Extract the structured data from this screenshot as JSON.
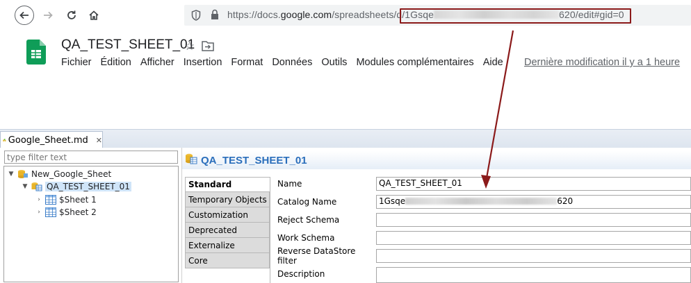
{
  "browser": {
    "url_prefix": "https://docs.",
    "url_domain": "google.com",
    "url_path_start": "/spreadsheets/d/1Gsqe",
    "url_path_end": "620/edit#gid=0"
  },
  "sheet": {
    "title": "QA_TEST_SHEET_01",
    "menu": [
      "Fichier",
      "Édition",
      "Afficher",
      "Insertion",
      "Format",
      "Données",
      "Outils",
      "Modules complémentaires",
      "Aide"
    ],
    "last_modified": "Dernière modification il y a 1 heure"
  },
  "ide": {
    "tab_label": "Google_Sheet.md",
    "filter_placeholder": "type filter text",
    "tree": {
      "root": "New_Google_Sheet",
      "child": "QA_TEST_SHEET_01",
      "sheet1": "$Sheet 1",
      "sheet2": "$Sheet 2"
    },
    "section_title": "QA_TEST_SHEET_01",
    "tabs": [
      "Standard",
      "Temporary Objects",
      "Customization",
      "Deprecated",
      "Externalize",
      "Core"
    ],
    "props": {
      "name_label": "Name",
      "name_value": "QA_TEST_SHEET_01",
      "catalog_label": "Catalog Name",
      "catalog_prefix": "1Gsqe",
      "catalog_suffix": "620",
      "reject_label": "Reject Schema",
      "work_label": "Work Schema",
      "reverse_label": "Reverse DataStore filter",
      "desc_label": "Description"
    }
  },
  "colors": {
    "highlight_box": "#8b1a1a",
    "arrow": "#8b1a1a",
    "section_title": "#2a6ebb",
    "sheets_green": "#0f9d58"
  }
}
